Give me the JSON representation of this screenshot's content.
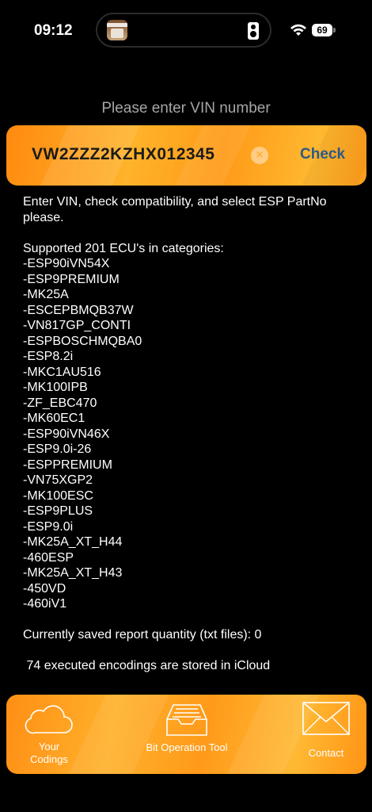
{
  "status": {
    "time": "09:12",
    "battery": "69"
  },
  "prompt": "Please enter VIN number",
  "vin": {
    "value": "VW2ZZZ2KZHX012345",
    "check_label": "Check"
  },
  "intro": "Enter VIN, check compatibility, and select ESP PartNo please.",
  "supported_title": "Supported 201 ECU's in categories:",
  "ecu_categories": [
    "-ESP90iVN54X",
    "-ESP9PREMIUM",
    "-MK25A",
    "-ESCEPBMQB37W",
    "-VN817GP_CONTI",
    "-ESPBOSCHMQBA0",
    "-ESP8.2i",
    "-MKC1AU516",
    "-MK100IPB",
    "-ZF_EBC470",
    "-MK60EC1",
    "-ESP90iVN46X",
    "-ESP9.0i-26",
    "-ESPPREMIUM",
    "-VN75XGP2",
    "-MK100ESC",
    "-ESP9PLUS",
    "-ESP9.0i",
    "-MK25A_XT_H44",
    "-460ESP",
    "-MK25A_XT_H43",
    "-450VD",
    "-460iV1"
  ],
  "saved_reports": "Currently saved report quantity (txt files): 0",
  "icloud": " 74 executed encodings are stored in iCloud",
  "tabs": {
    "codings": "Your Codings",
    "bit_tool": "Bit Operation Tool",
    "contact": "Contact"
  },
  "colors": {
    "accent_orange": "#FFA726",
    "check_text": "#2C5A86",
    "background": "#000000"
  }
}
